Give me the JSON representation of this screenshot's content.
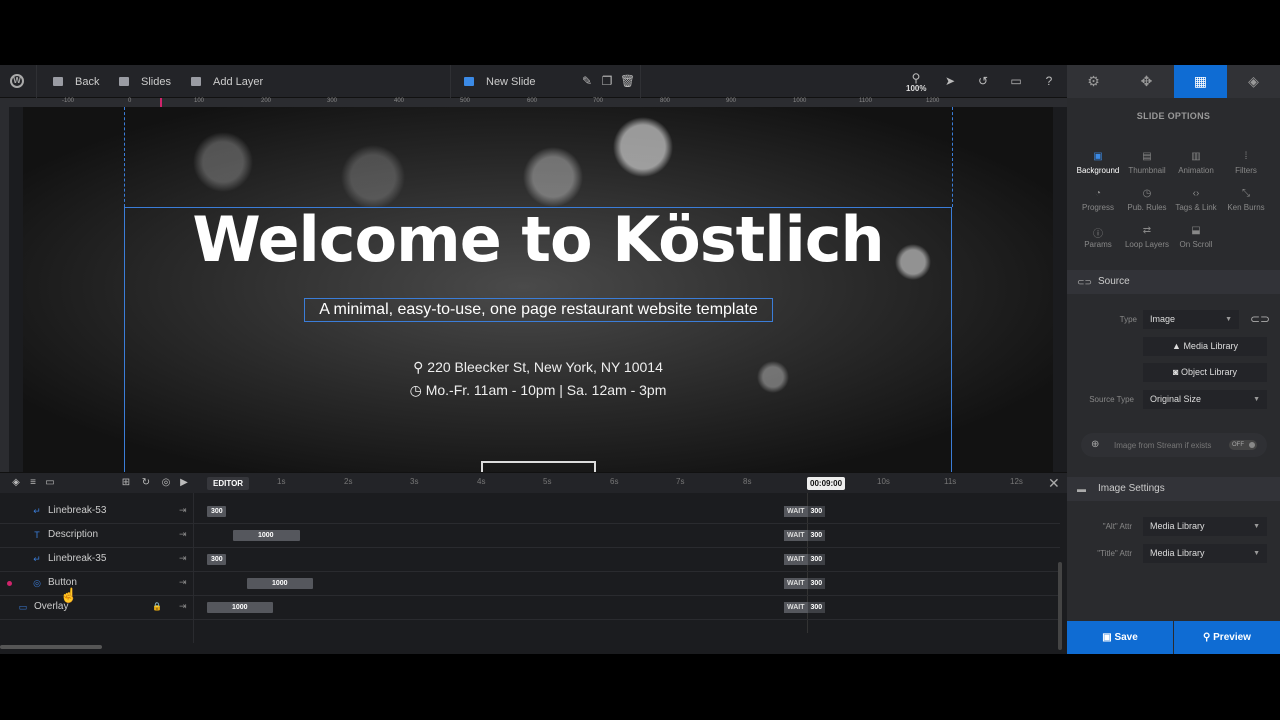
{
  "toolbar": {
    "back_label": "Back",
    "slides_label": "Slides",
    "add_layer_label": "Add Layer",
    "slide_name": "New Slide",
    "zoom": "100%"
  },
  "ruler": {
    "marks": [
      "-100",
      "0",
      "100",
      "200",
      "300",
      "400",
      "500",
      "600",
      "700",
      "800",
      "900",
      "1000",
      "1100",
      "1200"
    ]
  },
  "hero": {
    "title": "Welcome to Köstlich",
    "subtitle": "A minimal, easy-to-use, one page restaurant website template",
    "address": "220 Bleecker St, New York, NY 10014",
    "hours": "Mo.-Fr. 11am - 10pm  |  Sa. 12am - 3pm"
  },
  "timeline": {
    "editor_label": "EDITOR",
    "seconds": [
      "1s",
      "2s",
      "3s",
      "4s",
      "5s",
      "6s",
      "7s",
      "8s",
      "10s",
      "11s",
      "12s"
    ],
    "current_time": "00:09:00",
    "layers": [
      {
        "name": "Linebreak-53",
        "icon": "linebreak-icon",
        "bar": "300",
        "wait": "WAIT",
        "wait_value": "300"
      },
      {
        "name": "Description",
        "icon": "text-icon",
        "bar": "1000",
        "wait": "WAIT",
        "wait_value": "300"
      },
      {
        "name": "Linebreak-35",
        "icon": "linebreak-icon",
        "bar": "300",
        "wait": "WAIT",
        "wait_value": "300"
      },
      {
        "name": "Button",
        "icon": "button-icon",
        "bar": "1000",
        "wait": "WAIT",
        "wait_value": "300"
      },
      {
        "name": "Overlay",
        "icon": "shape-icon",
        "bar": "1000",
        "wait": "WAIT",
        "wait_value": "300"
      }
    ]
  },
  "panel": {
    "title": "SLIDE OPTIONS",
    "options": [
      "Background",
      "Thumbnail",
      "Animation",
      "Filters",
      "Progress",
      "Pub. Rules",
      "Tags & Link",
      "Ken Burns",
      "Params",
      "Loop Layers",
      "On Scroll"
    ],
    "source_section": "Source",
    "type_label": "Type",
    "type_value": "Image",
    "media_library": "Media Library",
    "object_library": "Object Library",
    "source_type_label": "Source Type",
    "source_type_value": "Original Size",
    "stream_label": "Image from Stream if exists",
    "stream_toggle": "OFF",
    "image_settings_section": "Image Settings",
    "alt_label": "\"Alt\" Attr",
    "alt_value": "Media Library",
    "title_attr_label": "\"Title\" Attr",
    "title_attr_value": "Media Library",
    "save_label": "Save",
    "preview_label": "Preview"
  },
  "colors": {
    "accent": "#0f6cd3",
    "guide": "#3b7dd8",
    "marker": "#d0246b"
  }
}
